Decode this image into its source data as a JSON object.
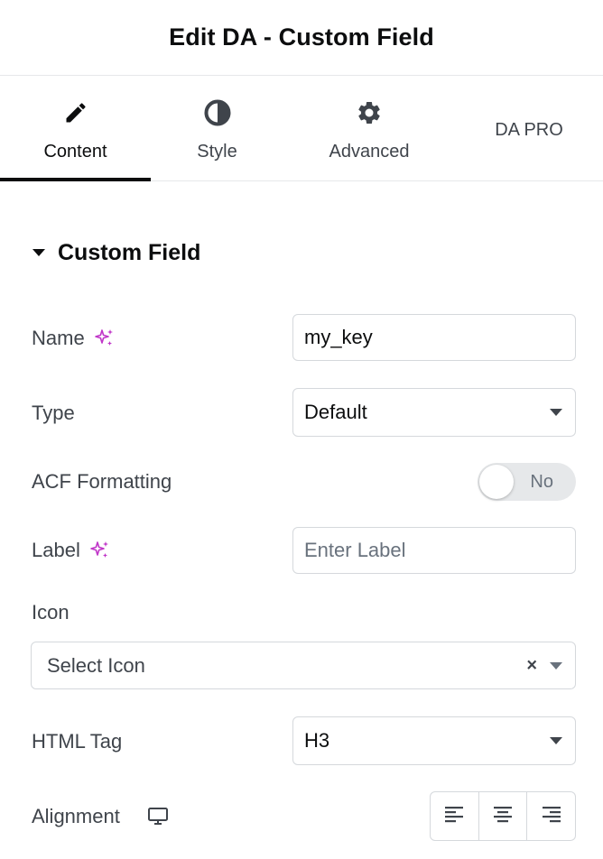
{
  "header": {
    "title": "Edit DA - Custom Field"
  },
  "tabs": [
    {
      "label": "Content",
      "icon": "pencil-icon",
      "active": true
    },
    {
      "label": "Style",
      "icon": "half-circle-icon",
      "active": false
    },
    {
      "label": "Advanced",
      "icon": "gear-icon",
      "active": false
    },
    {
      "label": "DA PRO",
      "icon": "",
      "active": false
    }
  ],
  "section": {
    "title": "Custom Field"
  },
  "fields": {
    "name": {
      "label": "Name",
      "value": "my_key"
    },
    "type": {
      "label": "Type",
      "value": "Default"
    },
    "acf": {
      "label": "ACF Formatting",
      "toggle_text": "No",
      "enabled": false
    },
    "label": {
      "label": "Label",
      "placeholder": "Enter Label"
    },
    "icon": {
      "label": "Icon",
      "placeholder": "Select Icon",
      "clear": "×"
    },
    "html_tag": {
      "label": "HTML Tag",
      "value": "H3"
    },
    "alignment": {
      "label": "Alignment",
      "options": [
        "left",
        "center",
        "right"
      ]
    }
  },
  "colors": {
    "dynamic_tag": "#c036c8",
    "text": "#3f444b",
    "border": "#d5d8dc"
  }
}
